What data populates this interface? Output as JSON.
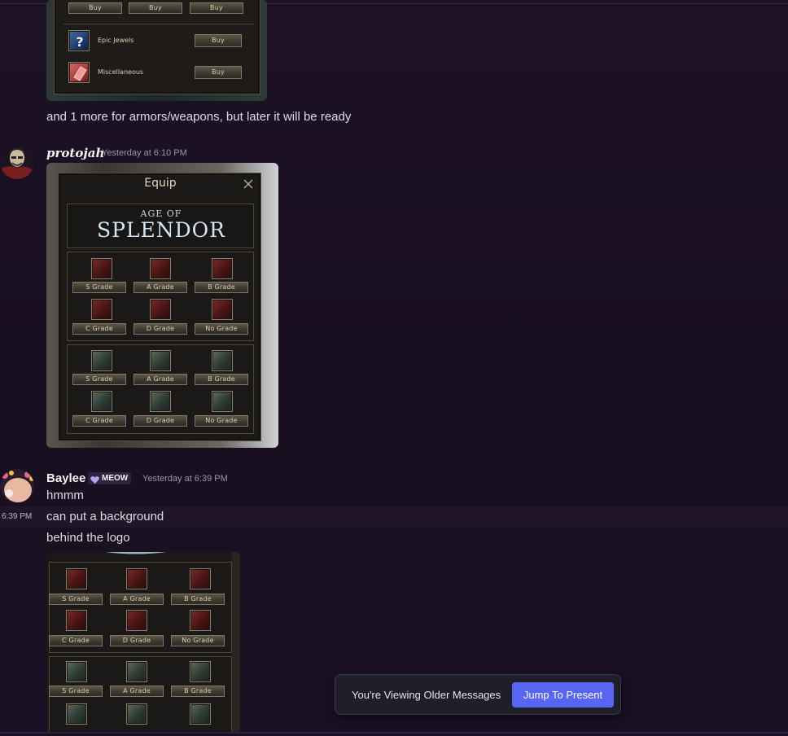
{
  "messages": {
    "msg1": {
      "text": "and 1 more for armors/weapons, but later it will be ready",
      "shop_panel": {
        "top_buy_labels": [
          "Buy",
          "Buy",
          "Buy"
        ],
        "rows": [
          {
            "label": "Epic Jewels",
            "buy": "Buy",
            "icon": "question-mark-jewel-icon"
          },
          {
            "label": "Miscellaneous",
            "buy": "Buy",
            "icon": "crystal-icon"
          }
        ]
      }
    },
    "msg2": {
      "username": "protojah",
      "timestamp": "Yesterday at 6:10 PM",
      "equip_panel": {
        "title": "Equip",
        "logo_top": "AGE OF",
        "logo_main": "SPLENDOR",
        "weapon_grades": [
          "S Grade",
          "A Grade",
          "B Grade",
          "C Grade",
          "D Grade",
          "No Grade"
        ],
        "armor_grades": [
          "S Grade",
          "A Grade",
          "B Grade",
          "C Grade",
          "D Grade",
          "No Grade"
        ]
      }
    },
    "msg3": {
      "username": "Baylee",
      "tag": "MEOW",
      "timestamp": "Yesterday at 6:39 PM",
      "lines": [
        "hmmm",
        "can put a background",
        "behind the logo"
      ],
      "hover_time": "6:39 PM",
      "equip_panel_crop": {
        "weapon_grades": [
          "S Grade",
          "A Grade",
          "B Grade",
          "C Grade",
          "D Grade",
          "No Grade"
        ],
        "armor_grades": [
          "S Grade",
          "A Grade",
          "B Grade"
        ]
      }
    }
  },
  "older_bar": {
    "text": "You're Viewing Older Messages",
    "button": "Jump To Present"
  },
  "colors": {
    "background": "#1a1022",
    "accent": "#5865f2",
    "tag_heart": "#b8a4f5"
  }
}
